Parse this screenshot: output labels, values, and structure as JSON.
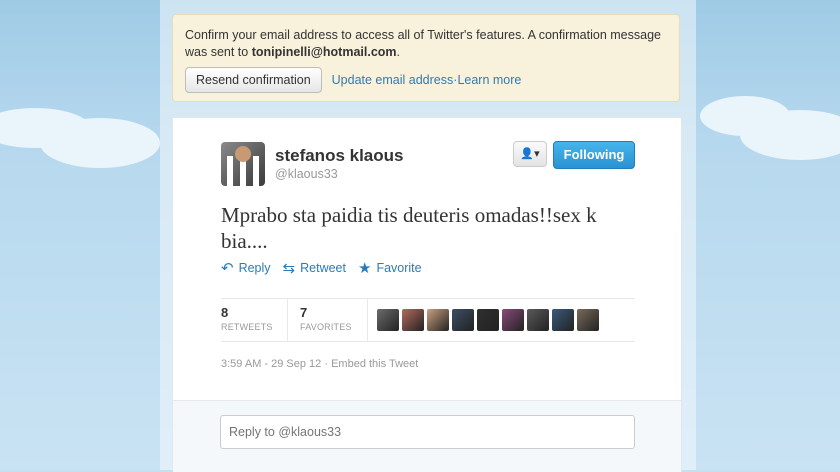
{
  "colors": {
    "accent": "#2b7bb9",
    "follow_button": "#2a92d2",
    "alert_bg": "#f8f2dc"
  },
  "alert": {
    "message_prefix": "Confirm your email address to access all of Twitter's features. A confirmation message was sent to ",
    "email": "tonipinelli@hotmail.com",
    "message_suffix": ".",
    "resend_label": "Resend confirmation",
    "update_link": "Update email address",
    "separator": " · ",
    "learn_link": "Learn more"
  },
  "tweet": {
    "author_name": "stefanos klaous",
    "author_handle": "@klaous33",
    "user_dropdown_icon": "user-icon",
    "user_dropdown_glyph": "▾",
    "follow_label": "Following",
    "text": "Mprabo sta paidia tis deuteris omadas!!sex k bia....",
    "actions": {
      "reply": {
        "icon": "reply-icon",
        "label": "Reply"
      },
      "retweet": {
        "icon": "retweet-icon",
        "label": "Retweet"
      },
      "favorite": {
        "icon": "star-icon",
        "label": "Favorite"
      }
    },
    "stats": {
      "retweets_count": "8",
      "retweets_label": "RETWEETS",
      "favorites_count": "7",
      "favorites_label": "FAVORITES"
    },
    "favoriter_avatars": [
      "#6b6b6b",
      "#b36a5e",
      "#c9a07e",
      "#3d4d66",
      "#2f2f2f",
      "#8a4a7a",
      "#5a5a5a",
      "#3a5a7a",
      "#7a6a5a"
    ],
    "timestamp": "3:59 AM - 29 Sep 12",
    "timestamp_separator": " · ",
    "embed_link": "Embed this Tweet"
  },
  "reply": {
    "placeholder": "Reply to @klaous33"
  }
}
